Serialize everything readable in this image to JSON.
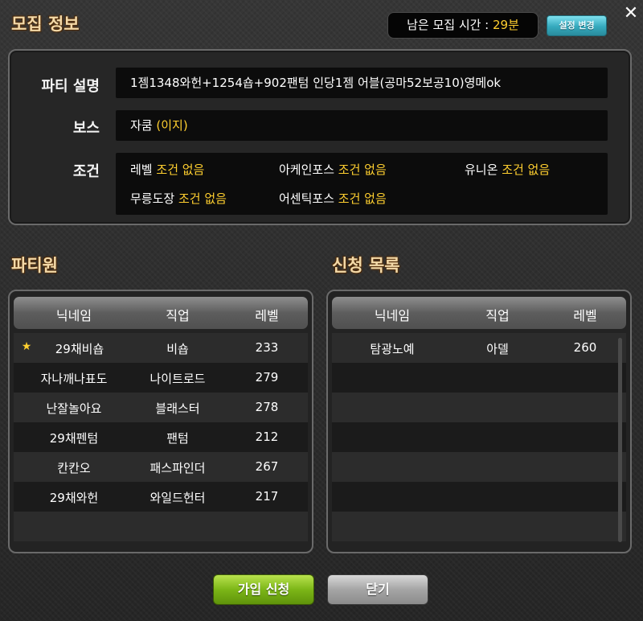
{
  "window": {
    "title": "모집 정보",
    "time_label": "남은 모집 시간 : ",
    "time_value": "29분",
    "change_button": "설정 변경",
    "close_icon": "close-icon"
  },
  "info": {
    "description_label": "파티 설명",
    "description": "1젬1348와헌+1254숍+902팬텀 인당1젬 어블(공마52보공10)영메ok",
    "boss_label": "보스",
    "boss_name": "자쿰",
    "boss_difficulty": "(이지)",
    "conditions_label": "조건",
    "conditions": [
      {
        "name": "레벨",
        "value": "조건 없음"
      },
      {
        "name": "아케인포스",
        "value": "조건 없음"
      },
      {
        "name": "유니온",
        "value": "조건 없음"
      },
      {
        "name": "무릉도장",
        "value": "조건 없음"
      },
      {
        "name": "어센틱포스",
        "value": "조건 없음"
      }
    ]
  },
  "party": {
    "title": "파티원",
    "columns": [
      "닉네임",
      "직업",
      "레벨"
    ],
    "leader_icon": "star-icon",
    "members": [
      {
        "name": "29채비숍",
        "job": "비숍",
        "level": "233"
      },
      {
        "name": "자나깨나표도",
        "job": "나이트로드",
        "level": "279"
      },
      {
        "name": "난잘놀아요",
        "job": "블래스터",
        "level": "278"
      },
      {
        "name": "29채펜텀",
        "job": "팬텀",
        "level": "212"
      },
      {
        "name": "칸칸오",
        "job": "패스파인더",
        "level": "267"
      },
      {
        "name": "29채와헌",
        "job": "와일드헌터",
        "level": "217"
      }
    ]
  },
  "applicants": {
    "title": "신청 목록",
    "columns": [
      "닉네임",
      "직업",
      "레벨"
    ],
    "items": [
      {
        "name": "탐광노예",
        "job": "아델",
        "level": "260"
      }
    ]
  },
  "buttons": {
    "join": "가입 신청",
    "close": "닫기"
  },
  "colors": {
    "accent_yellow": "#ffcf2f",
    "title_color": "#f3d9a8",
    "join_green": "#7cb617",
    "change_cyan": "#34a9bd"
  }
}
